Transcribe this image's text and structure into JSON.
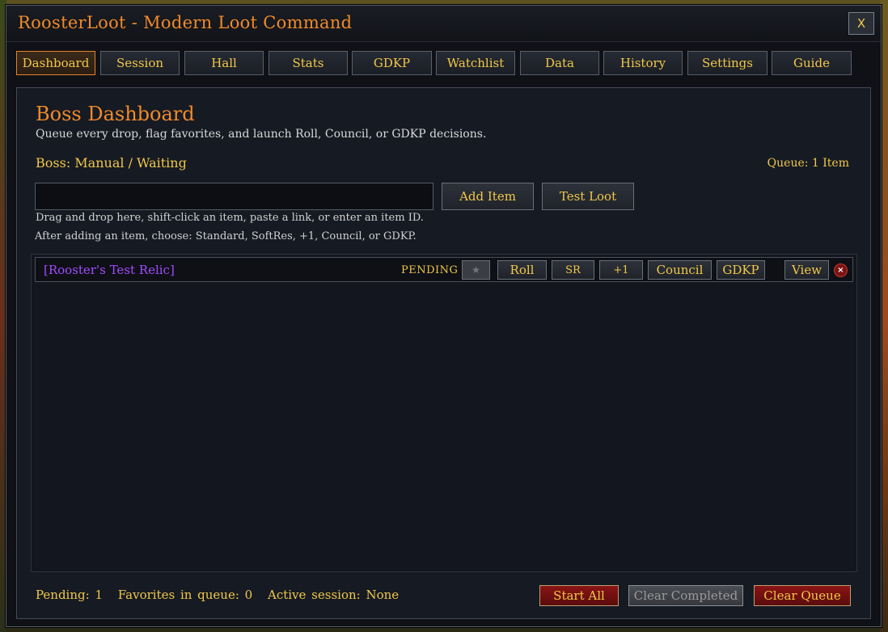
{
  "window": {
    "title": "RoosterLoot - Modern Loot Command",
    "close_label": "X"
  },
  "tabs": [
    {
      "label": "Dashboard",
      "active": true
    },
    {
      "label": "Session"
    },
    {
      "label": "Hall"
    },
    {
      "label": "Stats"
    },
    {
      "label": "GDKP"
    },
    {
      "label": "Watchlist"
    },
    {
      "label": "Data"
    },
    {
      "label": "History"
    },
    {
      "label": "Settings"
    },
    {
      "label": "Guide"
    }
  ],
  "dashboard": {
    "title": "Boss Dashboard",
    "subtitle": "Queue every drop, flag favorites, and launch Roll, Council, or GDKP decisions.",
    "boss": "Boss: Manual / Waiting",
    "queue_count": "Queue: 1 Item",
    "item_input_value": "",
    "add_item_label": "Add Item",
    "test_loot_label": "Test Loot",
    "hint_drag": "Drag and drop here, shift-click an item, paste a link, or enter an item ID.",
    "hint_choose": "After adding an item, choose: Standard, SoftRes, +1, Council, or GDKP."
  },
  "queue": [
    {
      "item": "[Rooster's Test Relic]",
      "status": "PENDING",
      "favorite_icon": "star-icon",
      "actions": [
        "Roll",
        "SR",
        "+1",
        "Council",
        "GDKP"
      ],
      "view_label": "View",
      "remove_label": "×"
    }
  ],
  "footer": {
    "pending": "Pending: 1",
    "favorites": "Favorites in queue: 0",
    "session": "Active session: None",
    "start_all": "Start All",
    "clear_completed": "Clear Completed",
    "clear_queue": "Clear Queue"
  },
  "colors": {
    "accent_orange": "#f08a2a",
    "gold_text": "#f0c848",
    "epic_purple": "#a14cff",
    "danger_red": "#8a1414"
  }
}
